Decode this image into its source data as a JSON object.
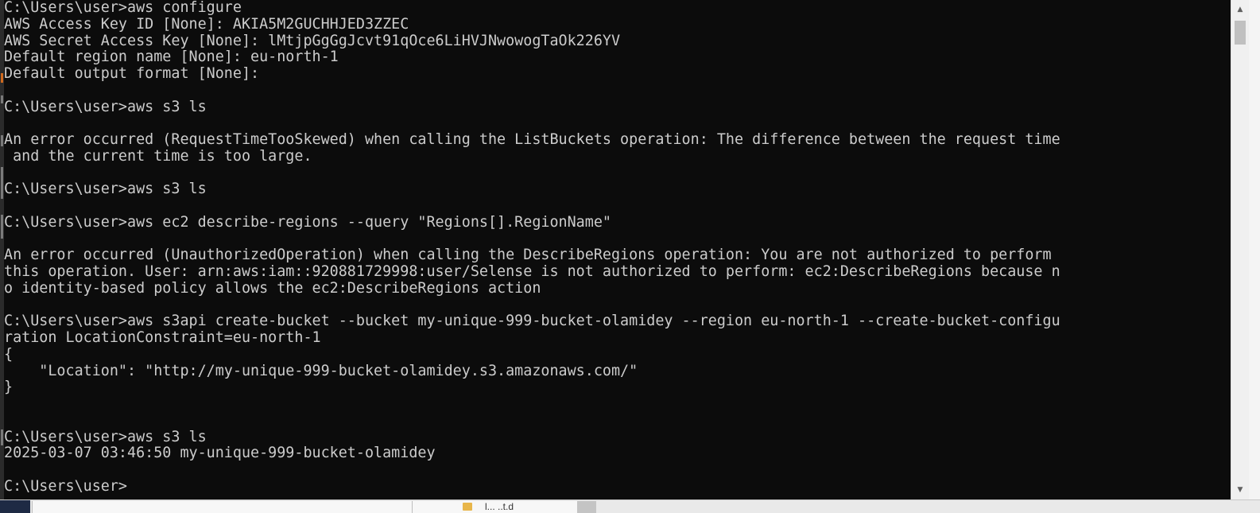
{
  "terminal": {
    "lines": [
      "C:\\Users\\user>aws configure",
      "AWS Access Key ID [None]: AKIA5M2GUCHHJED3ZZEC",
      "AWS Secret Access Key [None]: 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",
      "Default region name [None]: eu-north-1",
      "Default output format [None]:",
      "",
      "C:\\Users\\user>aws s3 ls",
      "",
      "An error occurred (RequestTimeTooSkewed) when calling the ListBuckets operation: The difference between the request time",
      " and the current time is too large.",
      "",
      "C:\\Users\\user>aws s3 ls",
      "",
      "C:\\Users\\user>aws ec2 describe-regions --query \"Regions[].RegionName\"",
      "",
      "An error occurred (UnauthorizedOperation) when calling the DescribeRegions operation: You are not authorized to perform",
      "this operation. User: arn:aws:iam::920881729998:user/Selense is not authorized to perform: ec2:DescribeRegions because n",
      "o identity-based policy allows the ec2:DescribeRegions action",
      "",
      "C:\\Users\\user>aws s3api create-bucket --bucket my-unique-999-bucket-olamidey --region eu-north-1 --create-bucket-configu",
      "ration LocationConstraint=eu-north-1",
      "{",
      "    \"Location\": \"http://my-unique-999-bucket-olamidey.s3.amazonaws.com/\"",
      "}",
      "",
      "",
      "C:\\Users\\user>aws s3 ls",
      "2025-03-07 03:46:50 my-unique-999-bucket-olamidey",
      "",
      "C:\\Users\\user>"
    ]
  },
  "scrollbar": {
    "up_glyph": "▲",
    "down_glyph": "▼"
  },
  "background_window": {
    "partial_label": "l...   ..t.d"
  },
  "colors": {
    "terminal_bg": "#0c0c0c",
    "terminal_text": "#cccccc",
    "scrollbar_bg": "#f0f0f0"
  },
  "icons": [
    "arrow-up-icon",
    "arrow-down-icon",
    "folder-icon"
  ]
}
